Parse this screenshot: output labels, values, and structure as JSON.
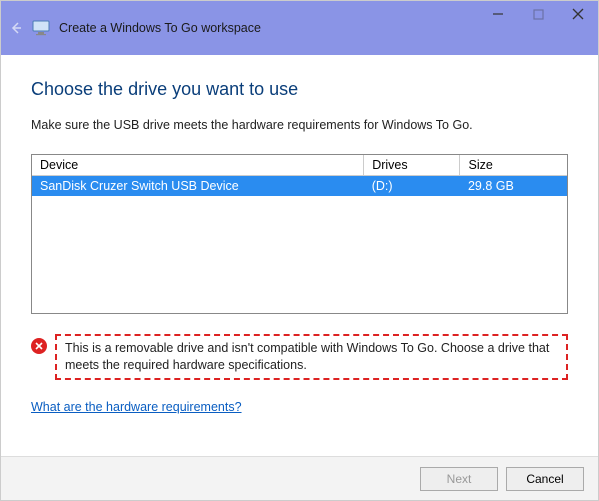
{
  "titlebar": {
    "title": "Create a Windows To Go workspace"
  },
  "heading": "Choose the drive you want to use",
  "subtext": "Make sure the USB drive meets the hardware requirements for Windows To Go.",
  "table": {
    "headers": {
      "device": "Device",
      "drives": "Drives",
      "size": "Size"
    },
    "rows": [
      {
        "device": "SanDisk Cruzer Switch USB Device",
        "drives": "(D:)",
        "size": "29.8 GB"
      }
    ]
  },
  "warning": "This is a removable drive and isn't compatible with Windows To Go. Choose a drive that meets the required hardware specifications.",
  "link": "What are the hardware requirements?",
  "buttons": {
    "next": "Next",
    "cancel": "Cancel"
  }
}
